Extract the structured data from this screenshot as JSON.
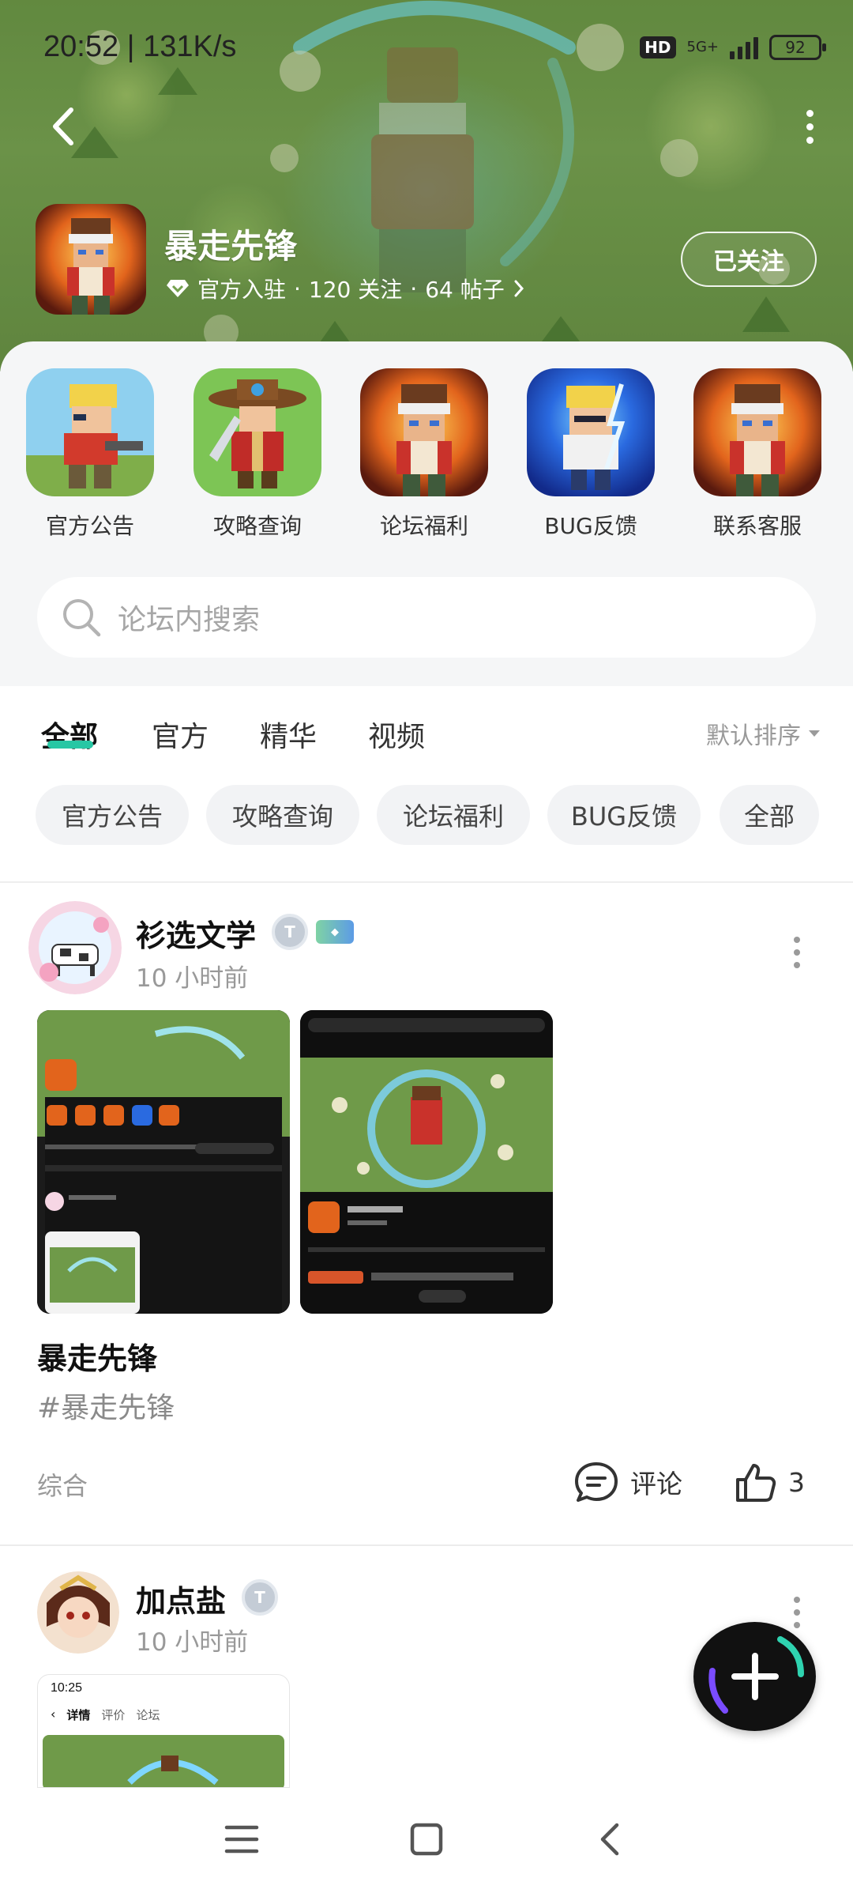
{
  "status_bar": {
    "time": "20:52 | 131K/s",
    "hd": "HD",
    "network": "5G+",
    "battery": "92"
  },
  "game": {
    "title": "暴走先锋",
    "official": "官方入驻",
    "followers": "120 关注",
    "posts": "64 帖子",
    "follow_button": "已关注"
  },
  "shortcuts": [
    {
      "label": "官方公告",
      "icon": "hero-gunner-icon"
    },
    {
      "label": "攻略查询",
      "icon": "cowboy-sword-icon"
    },
    {
      "label": "论坛福利",
      "icon": "hero-fire-icon"
    },
    {
      "label": "BUG反馈",
      "icon": "hero-lightning-icon"
    },
    {
      "label": "联系客服",
      "icon": "hero-fire-icon"
    }
  ],
  "search": {
    "placeholder": "论坛内搜索"
  },
  "tabs": {
    "items": [
      "全部",
      "官方",
      "精华",
      "视频"
    ],
    "active": "全部",
    "sort_label": "默认排序"
  },
  "chips": [
    "官方公告",
    "攻略查询",
    "论坛福利",
    "BUG反馈",
    "全部"
  ],
  "posts": [
    {
      "author": "衫选文学",
      "time": "10 小时前",
      "title": "暴走先锋",
      "tag": "#暴走先锋",
      "category": "综合",
      "comment_label": "评论",
      "likes": "3"
    },
    {
      "author": "加点盐",
      "time": "10 小时前",
      "shot_time": "10:25",
      "shot_tabs": [
        "详情",
        "评价",
        "论坛"
      ]
    }
  ],
  "colors": {
    "accent": "#27c7a4",
    "hero_green": "#74a04e",
    "sheet_bg": "#f5f6f7"
  }
}
